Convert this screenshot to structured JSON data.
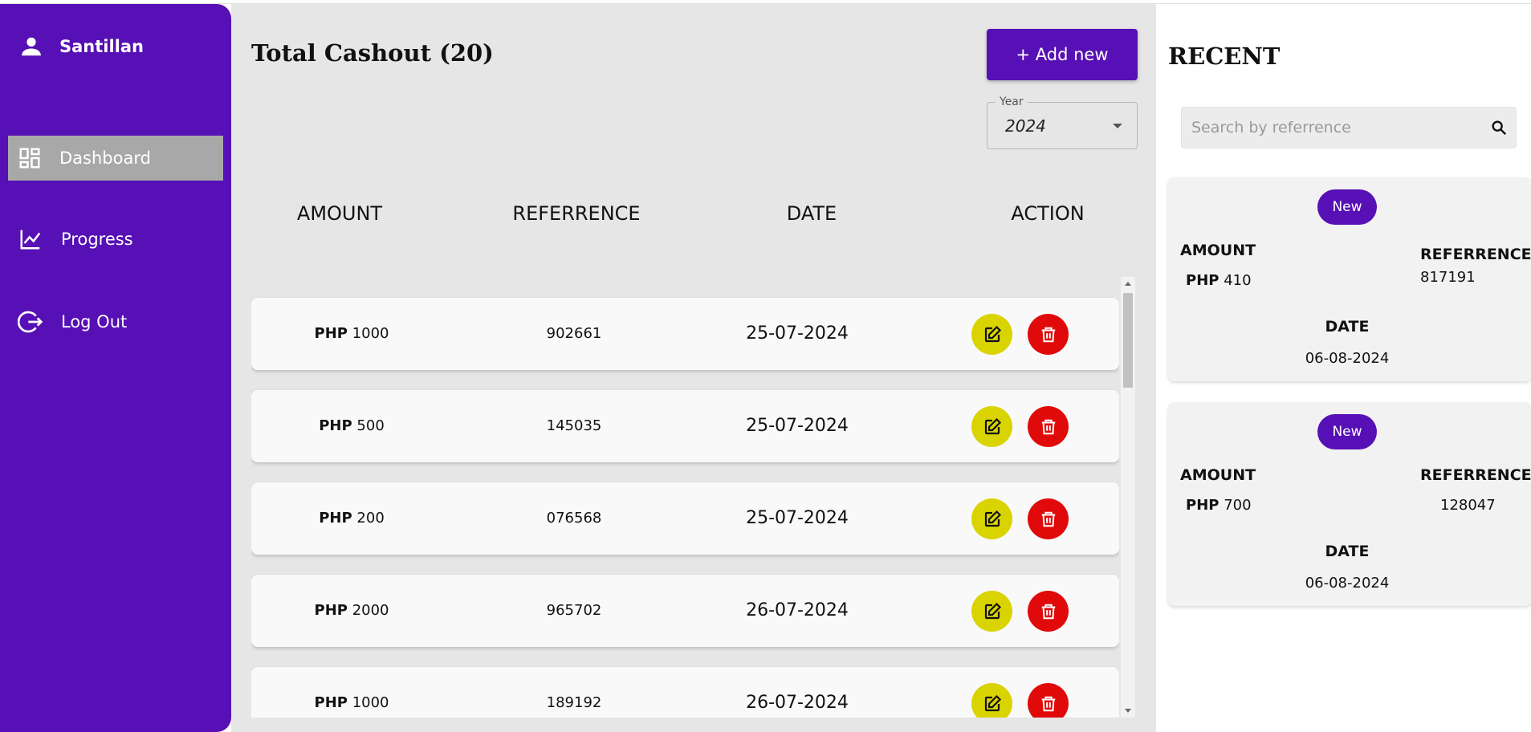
{
  "user": {
    "name": "Santillan"
  },
  "nav": [
    {
      "label": "Dashboard",
      "active": true
    },
    {
      "label": "Progress",
      "active": false
    },
    {
      "label": "Log Out",
      "active": false
    }
  ],
  "main": {
    "title": "Total Cashout (20)",
    "add_button": "+ Add new",
    "year_filter": {
      "legend": "Year",
      "value": "2024"
    },
    "columns": [
      "AMOUNT",
      "REFERRENCE",
      "DATE",
      "ACTION"
    ],
    "rows": [
      {
        "currency": "PHP",
        "amount": "1000",
        "reference": "902661",
        "date": "25-07-2024"
      },
      {
        "currency": "PHP",
        "amount": "500",
        "reference": "145035",
        "date": "25-07-2024"
      },
      {
        "currency": "PHP",
        "amount": "200",
        "reference": "076568",
        "date": "25-07-2024"
      },
      {
        "currency": "PHP",
        "amount": "2000",
        "reference": "965702",
        "date": "26-07-2024"
      },
      {
        "currency": "PHP",
        "amount": "1000",
        "reference": "189192",
        "date": "26-07-2024"
      }
    ]
  },
  "recent": {
    "title": "RECENT",
    "search_placeholder": "Search by referrence",
    "cards": [
      {
        "badge": "New",
        "amount_label": "AMOUNT",
        "currency": "PHP",
        "amount": "410",
        "ref_label": "REFERRENCE",
        "reference": "817191",
        "date_label": "DATE",
        "date": "06-08-2024"
      },
      {
        "badge": "New",
        "amount_label": "AMOUNT",
        "currency": "PHP",
        "amount": "700",
        "ref_label": "REFERRENCE",
        "reference": "128047",
        "date_label": "DATE",
        "date": "06-08-2024"
      }
    ]
  },
  "colors": {
    "brand": "#5710b5",
    "edit": "#d9d400",
    "delete": "#e00a0a",
    "active_nav": "#a8a8a8"
  }
}
